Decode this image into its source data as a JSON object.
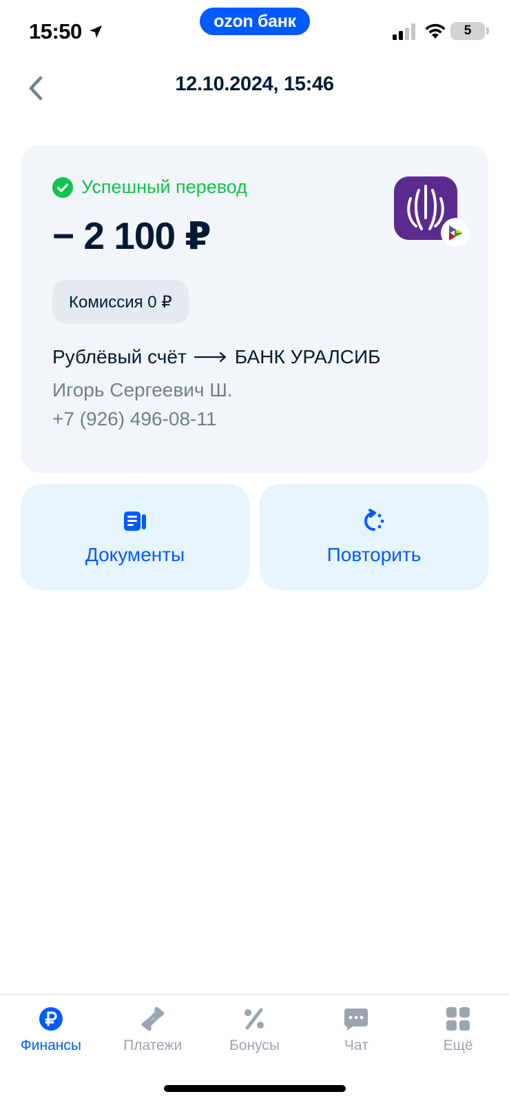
{
  "status_bar": {
    "time": "15:50",
    "brand": "ozon банк",
    "battery": "5"
  },
  "header": {
    "title": "12.10.2024, 15:46",
    "back_icon": "chevron-left-icon"
  },
  "transfer": {
    "status": "Успешный перевод",
    "amount": "− 2 100 ₽",
    "fee": "Комиссия 0 ₽",
    "from_account": "Рублёвый счёт",
    "to_bank": "БАНК УРАЛСИБ",
    "recipient_name": "Игорь Сергеевич Ш.",
    "recipient_phone": "+7 (926) 496-08-11",
    "bank_logo_color": "#5a2a8f",
    "status_color": "#10c44c"
  },
  "actions": {
    "documents": "Документы",
    "repeat": "Повторить"
  },
  "tabs": [
    {
      "label": "Финансы",
      "icon": "ruble-icon",
      "active": true
    },
    {
      "label": "Платежи",
      "icon": "transfer-arrows-icon",
      "active": false
    },
    {
      "label": "Бонусы",
      "icon": "percent-icon",
      "active": false
    },
    {
      "label": "Чат",
      "icon": "chat-icon",
      "active": false
    },
    {
      "label": "Ещё",
      "icon": "grid-icon",
      "active": false
    }
  ],
  "colors": {
    "accent": "#005bff",
    "card_bg": "#f2f5f9",
    "action_bg": "#e6f4fd",
    "muted_text": "#707f8d",
    "tab_inactive": "#9aa5b1"
  }
}
